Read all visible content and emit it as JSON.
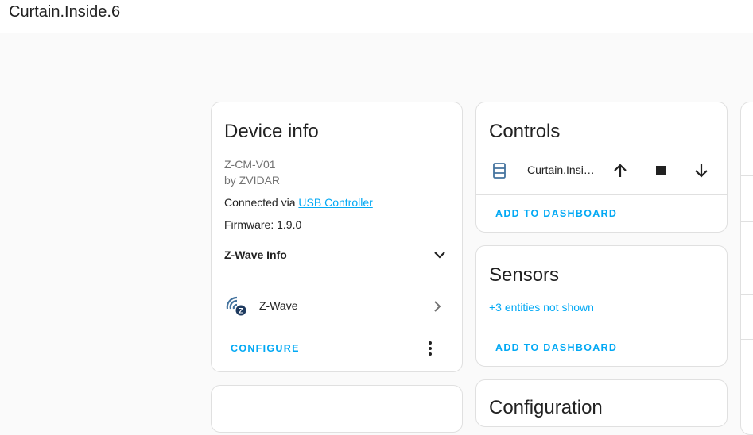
{
  "header": {
    "title": "Curtain.Inside.6"
  },
  "device_info": {
    "title": "Device info",
    "model": "Z-CM-V01",
    "manufacturer": "by ZVIDAR",
    "connected_prefix": "Connected via ",
    "connected_link": "USB Controller",
    "firmware": "Firmware: 1.9.0",
    "zwave_info_label": "Z-Wave Info",
    "integration_label": "Z-Wave",
    "configure_label": "CONFIGURE"
  },
  "controls": {
    "title": "Controls",
    "entity_name": "Curtain.Insi…",
    "add_to_dashboard_label": "ADD TO DASHBOARD"
  },
  "sensors": {
    "title": "Sensors",
    "hidden_entities": "+3 entities not shown",
    "add_to_dashboard_label": "ADD TO DASHBOARD"
  },
  "configuration": {
    "title": "Configuration"
  },
  "colors": {
    "accent": "#03a9f4",
    "icon": "#44739e",
    "text": "#212121",
    "muted": "#727272"
  }
}
